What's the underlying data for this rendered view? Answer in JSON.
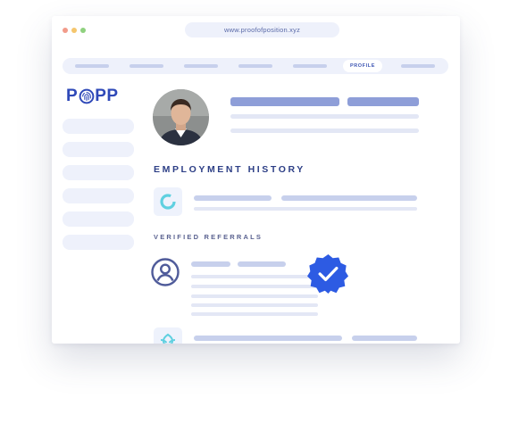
{
  "browser": {
    "url": "www.proofofposition.xyz",
    "controls": [
      "close-dot",
      "minimize-dot",
      "maximize-dot"
    ],
    "control_colors": [
      "#f29b8a",
      "#f5c66d",
      "#8fd17f"
    ]
  },
  "nav": {
    "active_tab_label": "PROFILE"
  },
  "logo": {
    "text_left": "P",
    "text_right": "PP"
  },
  "sections": {
    "employment_title": "EMPLOYMENT HISTORY",
    "referrals_title": "VERIFIED REFERRALS"
  },
  "colors": {
    "brand": "#2f49b8",
    "placeholder_dark": "#8e9ed8",
    "placeholder_mid": "#c7d0ec",
    "placeholder_light": "#e3e7f5",
    "verified_badge": "#2d5be3",
    "teal_icon": "#5fd0e0"
  },
  "icons": {
    "verified": "verified-badge-icon",
    "user": "user-circle-icon",
    "company_1": "ring-logo-icon",
    "company_2": "leaf-logo-icon"
  }
}
